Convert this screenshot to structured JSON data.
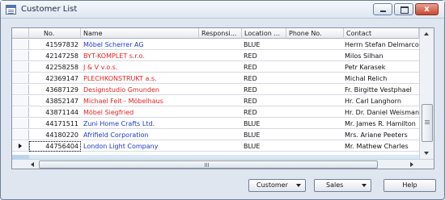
{
  "window": {
    "title": "Customer List",
    "close_glyph": "x",
    "icons": [
      "app-icon",
      "minimize-icon",
      "maximize-icon",
      "close-icon"
    ]
  },
  "grid": {
    "columns": [
      "No.",
      "Name",
      "Responsi...",
      "Location ...",
      "Phone No.",
      "Contact"
    ],
    "rows": [
      {
        "no": "41597832",
        "name": "Möbel Scherrer AG",
        "responsibility": "",
        "location": "BLUE",
        "phone": "",
        "contact": "Herrn Stefan Delmarco",
        "name_color": "blue"
      },
      {
        "no": "42147258",
        "name": "BYT-KOMPLET s.r.o.",
        "responsibility": "",
        "location": "RED",
        "phone": "",
        "contact": "Milos Silhan",
        "name_color": "red"
      },
      {
        "no": "42258258",
        "name": "J & V v.o.s.",
        "responsibility": "",
        "location": "RED",
        "phone": "",
        "contact": "Petr Karasek",
        "name_color": "red"
      },
      {
        "no": "42369147",
        "name": "PLECHKONSTRUKT a.s.",
        "responsibility": "",
        "location": "RED",
        "phone": "",
        "contact": "Michal Relich",
        "name_color": "red"
      },
      {
        "no": "43687129",
        "name": "Designstudio Gmunden",
        "responsibility": "",
        "location": "RED",
        "phone": "",
        "contact": "Fr. Birgitte Vestphael",
        "name_color": "red"
      },
      {
        "no": "43852147",
        "name": "Michael Feit - Möbelhaus",
        "responsibility": "",
        "location": "RED",
        "phone": "",
        "contact": "Hr. Carl Langhorn",
        "name_color": "red"
      },
      {
        "no": "43871144",
        "name": "Möbel Siegfried",
        "responsibility": "",
        "location": "RED",
        "phone": "",
        "contact": "Hr. Dr. Daniel Weisman",
        "name_color": "red"
      },
      {
        "no": "44171511",
        "name": "Zuni Home Crafts Ltd.",
        "responsibility": "",
        "location": "BLUE",
        "phone": "",
        "contact": "Mr. James R. Hamilton",
        "name_color": "blue"
      },
      {
        "no": "44180220",
        "name": "Afrifield Corporation",
        "responsibility": "",
        "location": "BLUE",
        "phone": "",
        "contact": "Mrs. Ariane Peeters",
        "name_color": "blue"
      },
      {
        "no": "44756404",
        "name": "London Light Company",
        "responsibility": "",
        "location": "BLUE",
        "phone": "",
        "contact": "Mr. Mathew Charles",
        "name_color": "blue",
        "current": true
      }
    ],
    "colors": {
      "blue": "#1f39d1",
      "red": "#e32323"
    }
  },
  "buttons": {
    "customer": "Customer",
    "sales": "Sales",
    "help": "Help"
  }
}
